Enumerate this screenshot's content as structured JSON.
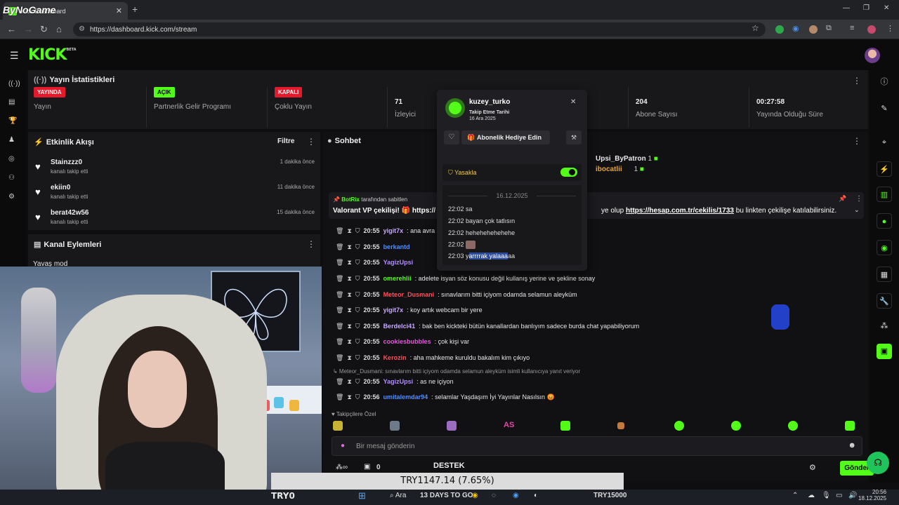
{
  "browser": {
    "watermark": "ByNoGame",
    "tab_title": "Kick Dashboard",
    "url": "https://dashboard.kick.com/stream"
  },
  "kick": {
    "logo": "KICK",
    "logo_tag": "BETA"
  },
  "stats": {
    "title": "Yayın İstatistikleri",
    "items": [
      {
        "badge": "YAYINDA",
        "label": "Yayın"
      },
      {
        "badge": "AÇIK",
        "label": "Partnerlik Gelir Programı"
      },
      {
        "badge": "KAPALI",
        "label": "Çoklu Yayın"
      },
      {
        "value": "71",
        "label": "İzleyici"
      },
      {
        "value": "204",
        "label": "Abone Sayısı"
      },
      {
        "value": "00:27:58",
        "label": "Yayında Olduğu Süre"
      }
    ]
  },
  "activity": {
    "title": "Etkinlik Akışı",
    "filter": "Filtre",
    "events": [
      {
        "name": "Stainzzz0",
        "sub": "kanalı takip etti",
        "time": "1 dakika önce"
      },
      {
        "name": "ekiin0",
        "sub": "kanalı takip etti",
        "time": "11 dakika önce"
      },
      {
        "name": "berat42w56",
        "sub": "kanalı takip etti",
        "time": "15 dakika önce"
      }
    ]
  },
  "actions": {
    "title": "Kanal Eylemleri",
    "first": "Yavaş mod"
  },
  "chat": {
    "title": "Sohbet",
    "top_users": [
      {
        "name": "Upsi_ByPatron",
        "count": "1"
      },
      {
        "name": "ibocatlii",
        "count": "1"
      }
    ],
    "pinned_by": "BotRix",
    "pinned_by_suffix": "tarafından sabitlen",
    "pinned_text": "Valorant VP çekilişi! 🎁 https://",
    "pinned_tail_a": "ye olup",
    "pinned_link": "https://hesap.com.tr/cekilis/1733",
    "pinned_tail_b": "bu linkten çekilişe katılabilirsiniz.",
    "messages": [
      {
        "time": "20:55",
        "user": "yigit7x",
        "text": ": ana avra"
      },
      {
        "time": "20:55",
        "user": "berkantd",
        "text": ""
      },
      {
        "time": "20:55",
        "user": "YagizUpsi",
        "text": ""
      },
      {
        "time": "20:55",
        "user": "omerehlii",
        "text": ": adelete isyan söz konusu değil kullanış yerine ve şekline sonay"
      },
      {
        "time": "20:55",
        "user": "Meteor_Dusmani",
        "text": ": sınavlarım bitti içiyom odamda selamun aleyküm"
      },
      {
        "time": "20:55",
        "user": "yigit7x",
        "text": ": koy artık webcam bir yere"
      },
      {
        "time": "20:55",
        "user": "Berdelci41",
        "text": ": bak ben kickteki bütün kanallardan banlıyım sadece burda chat yapabiliyorum"
      },
      {
        "time": "20:55",
        "user": "cookiesbubbles",
        "text": ": çok kişi var"
      },
      {
        "time": "20:55",
        "user": "Kerozin",
        "text": ": aha mahkeme kuruldu bakalım kim çıkıyo"
      },
      {
        "time": "20:55",
        "user": "YagizUpsi",
        "text": ": as ne içiyon"
      },
      {
        "time": "20:56",
        "user": "umitalemdar94",
        "text": ": selamlar Yaşdaşım İyi Yayınlar Nasılsın 😡"
      }
    ],
    "reply_note": "↳ Meteor_Dusmani: sınavlarım bitti içiyom odamda selamun aleyküm isimli kullanıcıya yanıt veriyor",
    "follower_only": "♥ Takipçilere Özel",
    "emote_text": "AS",
    "input_placeholder": "Bir mesaj gönderin",
    "send": "Gönder",
    "footer_count": "0"
  },
  "popup": {
    "username": "kuzey_turko",
    "follow_label": "Takip Etme Tarihi",
    "follow_date": "16 Ara 2025",
    "gift_button": "Abonelik Hediye Edin",
    "ban_label": "Yasakla",
    "ban_on": true,
    "log_date": "16.12.2025",
    "log": [
      {
        "time": "22:02",
        "text": "sa"
      },
      {
        "time": "22:02",
        "text": "bayan çok tatlısın"
      },
      {
        "time": "22:02",
        "text": "hehehehehehehe"
      },
      {
        "time": "22:02",
        "text": ""
      },
      {
        "time": "22:03",
        "text_pre": "y",
        "text_hl": "arrrrak yalaaa",
        "text_post": "aa"
      }
    ]
  },
  "overlay": {
    "ticker": "TRY1147.14 (7.65%)",
    "try0": "TRY0",
    "destek": "DESTEK",
    "days": "13 DAYS TO GO",
    "try15000": "TRY15000"
  },
  "taskbar": {
    "search": "Ara",
    "time": "20:56",
    "date": "18.12.2025"
  },
  "colors": {
    "accent": "#53fc18",
    "live": "#e3192c"
  }
}
